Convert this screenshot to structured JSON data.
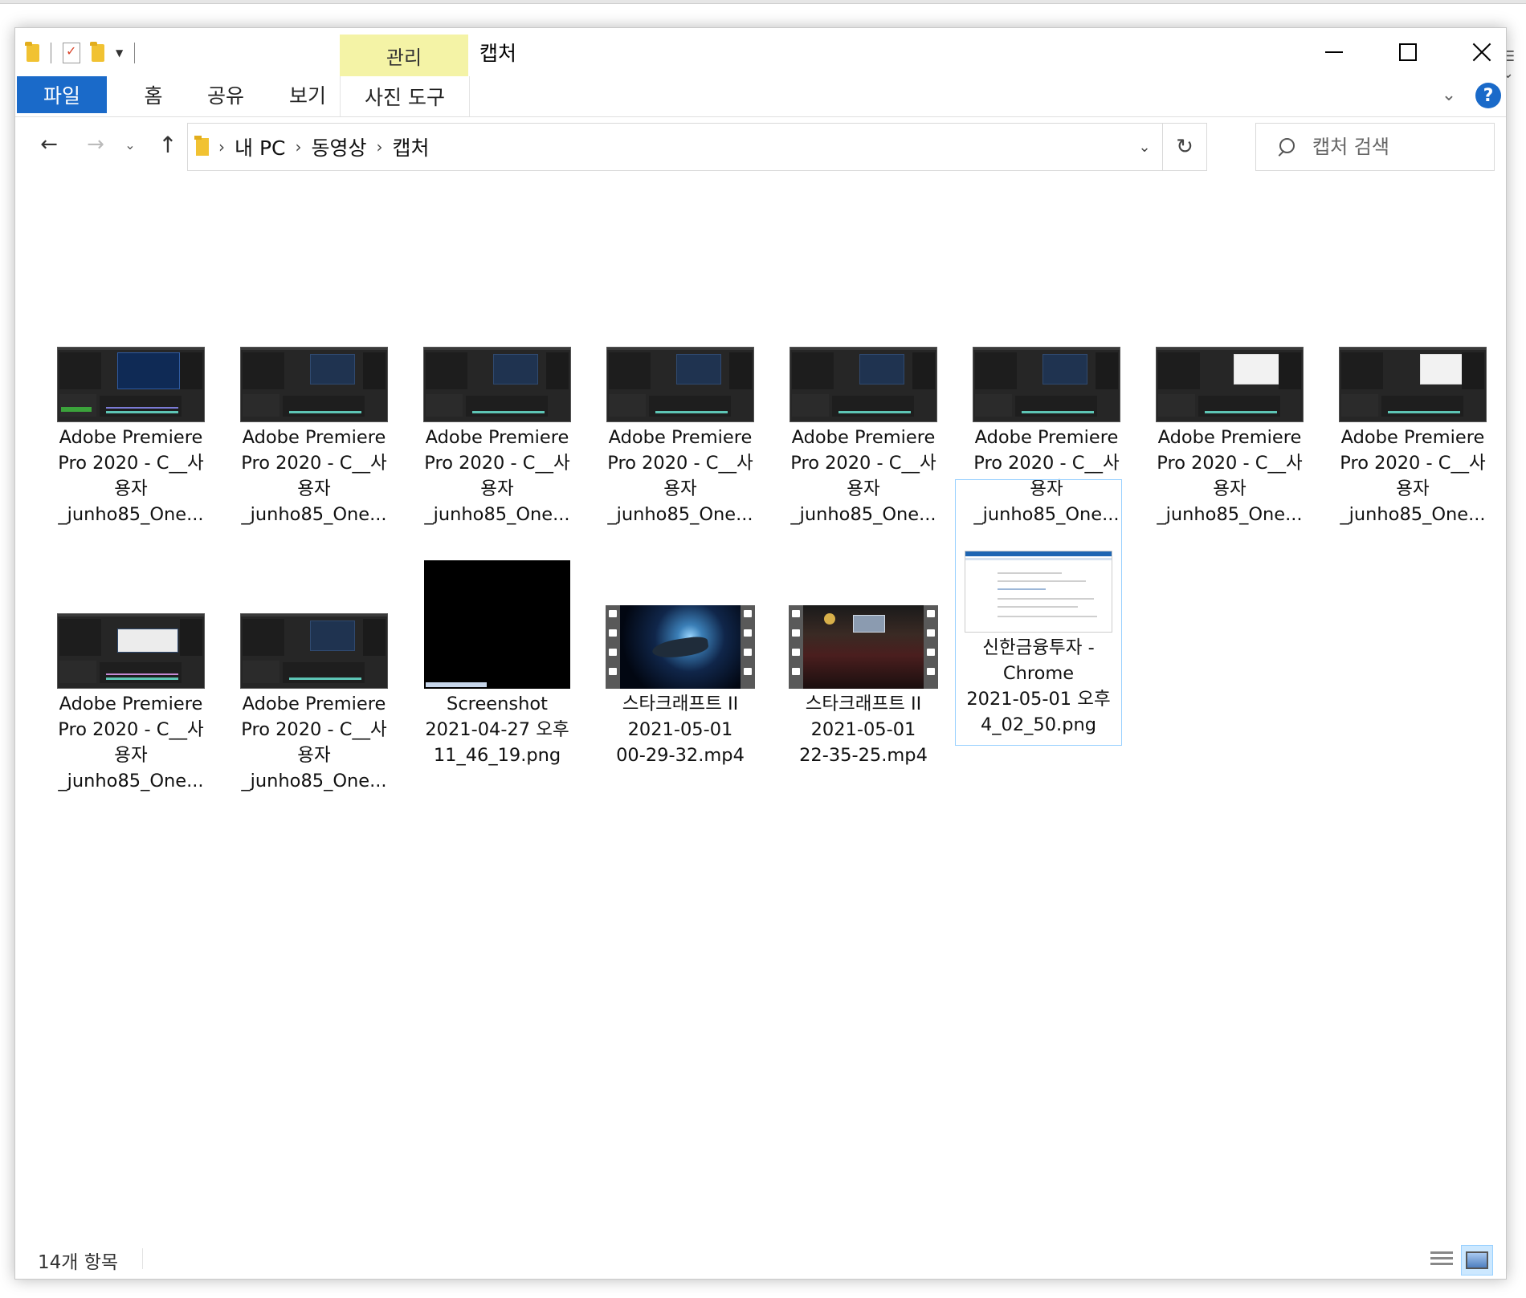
{
  "window": {
    "title": "캡처",
    "context_tab_group": "관리"
  },
  "ribbon": {
    "tabs": [
      {
        "label": "파일"
      },
      {
        "label": "홈"
      },
      {
        "label": "공유"
      },
      {
        "label": "보기"
      },
      {
        "label": "사진 도구"
      }
    ],
    "help": "?"
  },
  "address": {
    "breadcrumbs": [
      "내 PC",
      "동영상",
      "캡처"
    ]
  },
  "search": {
    "placeholder": "캡처 검색"
  },
  "files": [
    {
      "name": "Adobe Premiere\nPro 2020 - C__사\n용자\n_junho85_One...",
      "type": "premiere",
      "icon": "thumbnail"
    },
    {
      "name": "Adobe Premiere\nPro 2020 - C__사\n용자\n_junho85_One...",
      "type": "premiere",
      "icon": "thumbnail"
    },
    {
      "name": "Adobe Premiere\nPro 2020 - C__사\n용자\n_junho85_One...",
      "type": "premiere",
      "icon": "thumbnail"
    },
    {
      "name": "Adobe Premiere\nPro 2020 - C__사\n용자\n_junho85_One...",
      "type": "premiere",
      "icon": "thumbnail"
    },
    {
      "name": "Adobe Premiere\nPro 2020 - C__사\n용자\n_junho85_One...",
      "type": "premiere",
      "icon": "thumbnail"
    },
    {
      "name": "Adobe Premiere\nPro 2020 - C__사\n용자\n_junho85_One...",
      "type": "premiere",
      "icon": "thumbnail"
    },
    {
      "name": "Adobe Premiere\nPro 2020 - C__사\n용자\n_junho85_One...",
      "type": "premiere",
      "icon": "thumbnail"
    },
    {
      "name": "Adobe Premiere\nPro 2020 - C__사\n용자\n_junho85_One...",
      "type": "premiere",
      "icon": "thumbnail"
    },
    {
      "name": "Adobe Premiere\nPro 2020 - C__사\n용자\n_junho85_One...",
      "type": "premiere",
      "icon": "thumbnail"
    },
    {
      "name": "Adobe Premiere\nPro 2020 - C__사\n용자\n_junho85_One...",
      "type": "premiere",
      "icon": "thumbnail"
    },
    {
      "name": "Screenshot\n2021-04-27 오후\n11_46_19.png",
      "type": "black",
      "icon": "thumbnail"
    },
    {
      "name": "스타크래프트 II\n2021-05-01\n00-29-32.mp4",
      "type": "video-space",
      "icon": "video-thumbnail"
    },
    {
      "name": "스타크래프트 II\n2021-05-01\n22-35-25.mp4",
      "type": "video-hall",
      "icon": "video-thumbnail"
    },
    {
      "name": "신한금융투자 -\nChrome\n2021-05-01 오후\n4_02_50.png",
      "type": "chrome",
      "icon": "thumbnail",
      "selected": true
    }
  ],
  "status": {
    "item_count": "14개 항목"
  },
  "colors": {
    "accent": "#1a6ac9",
    "context_tab": "#f4f3a6",
    "selection_border": "#99d1ff"
  }
}
